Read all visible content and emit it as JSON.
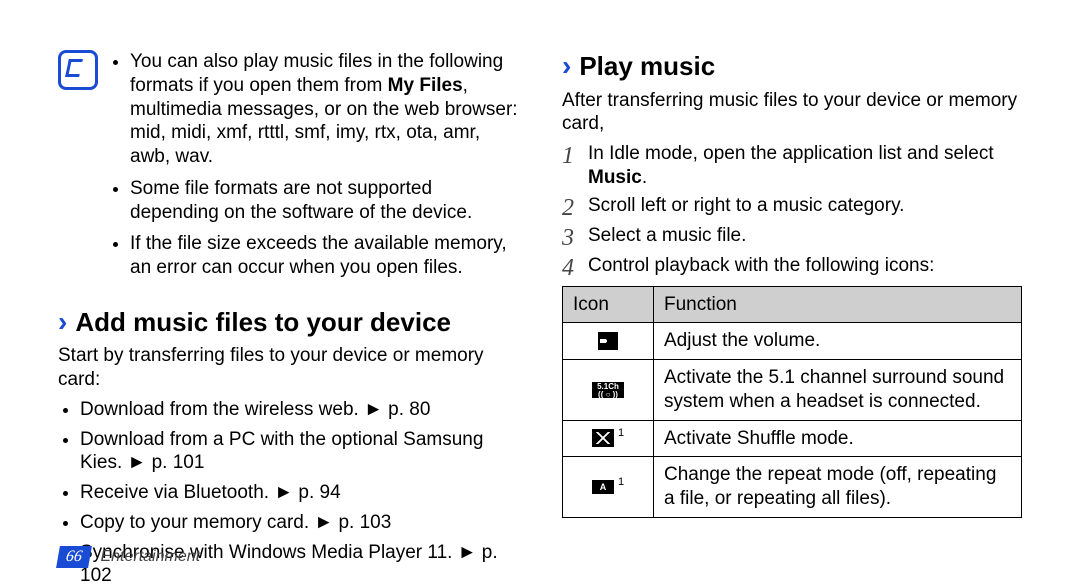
{
  "note": {
    "items": [
      {
        "pre": "You can also play music files in the following formats if you open them from ",
        "bold": "My Files",
        "post": ", multimedia messages, or on the web browser: mid, midi, xmf, rtttl, smf, imy, rtx, ota, amr, awb, wav."
      },
      {
        "text": "Some file formats are not supported depending on the software of the device."
      },
      {
        "text": "If the file size exceeds the available memory, an error can occur when you open files."
      }
    ]
  },
  "add": {
    "heading": "Add music files to your device",
    "intro": "Start by transferring files to your device or memory card:",
    "bullets": [
      "Download from the wireless web. ► p. 80",
      "Download from a PC with the optional Samsung Kies. ► p. 101",
      "Receive via Bluetooth. ► p. 94",
      "Copy to your memory card. ► p. 103",
      "Synchronise with Windows Media Player 11. ► p. 102"
    ]
  },
  "play": {
    "heading": "Play music",
    "intro": "After transferring music files to your device or memory card,",
    "steps": [
      {
        "n": "1",
        "pre": "In Idle mode, open the application list and select ",
        "bold": "Music",
        "post": "."
      },
      {
        "n": "2",
        "text": "Scroll left or right to a music category."
      },
      {
        "n": "3",
        "text": "Select a music file."
      },
      {
        "n": "4",
        "text": "Control playback with the following icons:"
      }
    ],
    "table": {
      "head": {
        "a": "Icon",
        "b": "Function"
      },
      "rows": [
        {
          "icon": "volume-icon",
          "func": "Adjust the volume."
        },
        {
          "icon": "5.1ch-icon",
          "func": "Activate the 5.1 channel surround sound system when a headset is connected."
        },
        {
          "icon": "shuffle-icon",
          "sup": "1",
          "func": "Activate Shuffle mode."
        },
        {
          "icon": "repeat-icon",
          "sup": "1",
          "func": "Change the repeat mode (off, repeating a file, or repeating all files)."
        }
      ]
    }
  },
  "footer": {
    "page": "66",
    "section": "Entertainment"
  }
}
